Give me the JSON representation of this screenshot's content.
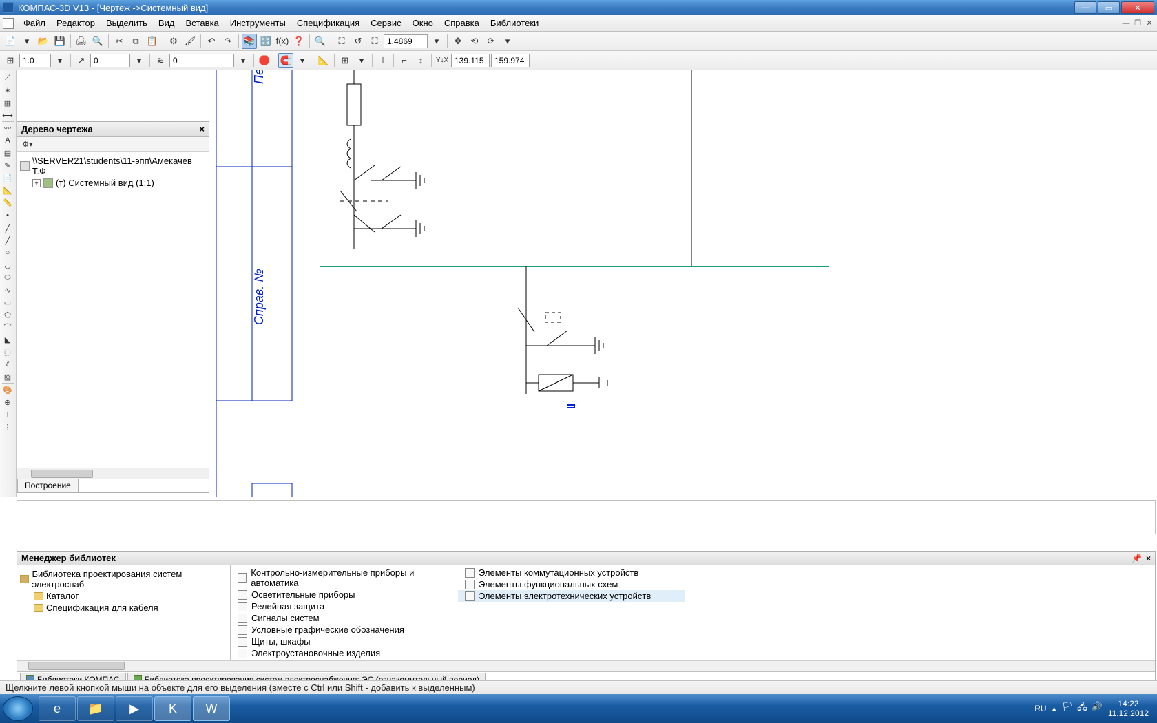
{
  "title": "КОМПАС-3D V13 - [Чертеж ->Системный вид]",
  "menu": [
    "Файл",
    "Редактор",
    "Выделить",
    "Вид",
    "Вставка",
    "Инструменты",
    "Спецификация",
    "Сервис",
    "Окно",
    "Справка",
    "Библиотеки"
  ],
  "toolbar1": {
    "zoom": "1.4869"
  },
  "toolbar2": {
    "combo1": "1.0",
    "combo2": "0",
    "combo3": "0",
    "coordX": "139.115",
    "coordY": "159.974"
  },
  "tree": {
    "title": "Дерево чертежа",
    "root": "\\\\SERVER21\\students\\11-эпп\\Амекачев Т.Ф",
    "child": "(т) Системный вид (1:1)",
    "bottomTab": "Построение"
  },
  "libManager": {
    "title": "Менеджер библиотек",
    "tree": {
      "root": "Библиотека проектирования систем электроснаб",
      "items": [
        "Каталог",
        "Спецификация для кабеля"
      ]
    },
    "col1": [
      "Контрольно-измерительные приборы и автоматика",
      "Осветительные приборы",
      "Релейная защита",
      "Сигналы систем",
      "Условные графические обозначения",
      "Щиты, шкафы",
      "Электроустановочные изделия"
    ],
    "col2": [
      "Элементы коммутационных устройств",
      "Элементы функциональных схем",
      "Элементы электротехнических устройств"
    ],
    "tabs": [
      "Библиотеки КОМПАС",
      "Библиотека проектирования систем электроснабжения: ЭС (ознакомительный период)"
    ]
  },
  "statusbar": "Щелкните левой кнопкой мыши на объекте для его выделения (вместе с Ctrl или Shift - добавить к выделенным)",
  "taskbar": {
    "lang": "RU",
    "time": "14:22",
    "date": "11.12.2012"
  }
}
